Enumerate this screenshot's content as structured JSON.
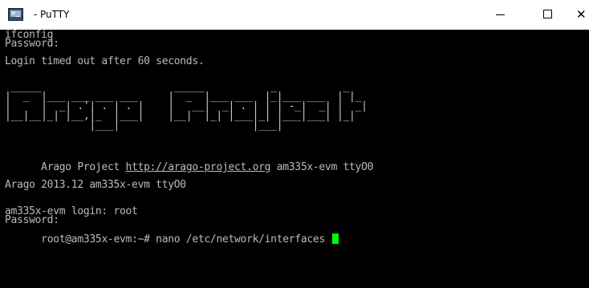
{
  "window": {
    "title": " - PuTTY",
    "icon": "putty-terminal-icon",
    "icon_glyph": ">_",
    "controls": {
      "minimize": "minimize-icon",
      "maximize": "maximize-icon",
      "close": "close-icon",
      "close_glyph": "✕"
    }
  },
  "terminal": {
    "background": "#000000",
    "foreground": "#bbbbbb",
    "cursor_color": "#00ff00",
    "lines": {
      "l1": "ifconfig",
      "l2": "Password:",
      "l3": "Login timed out after 60 seconds."
    },
    "banner": [
      " _____                      _____           _           _   ",
      "|  _  |___ ___ ___ ___     |  _  |___ ___  |_|___ ___  | |_ ",
      "|     |  _| .'| . | . |    |   __|  _| . | | | -_|  _| |  _|",
      "|__|__|_| |__,|_  |___|    |__|  |_| |___|_| |___|___| |_|  ",
      "              |___|                      |___|              "
    ],
    "project_line": {
      "prefix": "Arago Project ",
      "url": "http://arago-project.org",
      "suffix": " am335x-evm ttyO0"
    },
    "version_line": "Arago 2013.12 am335x-evm ttyO0",
    "login_line": "am335x-evm login: root",
    "password_line": "Password:",
    "prompt_line": "root@am335x-evm:~# nano /etc/network/interfaces "
  }
}
